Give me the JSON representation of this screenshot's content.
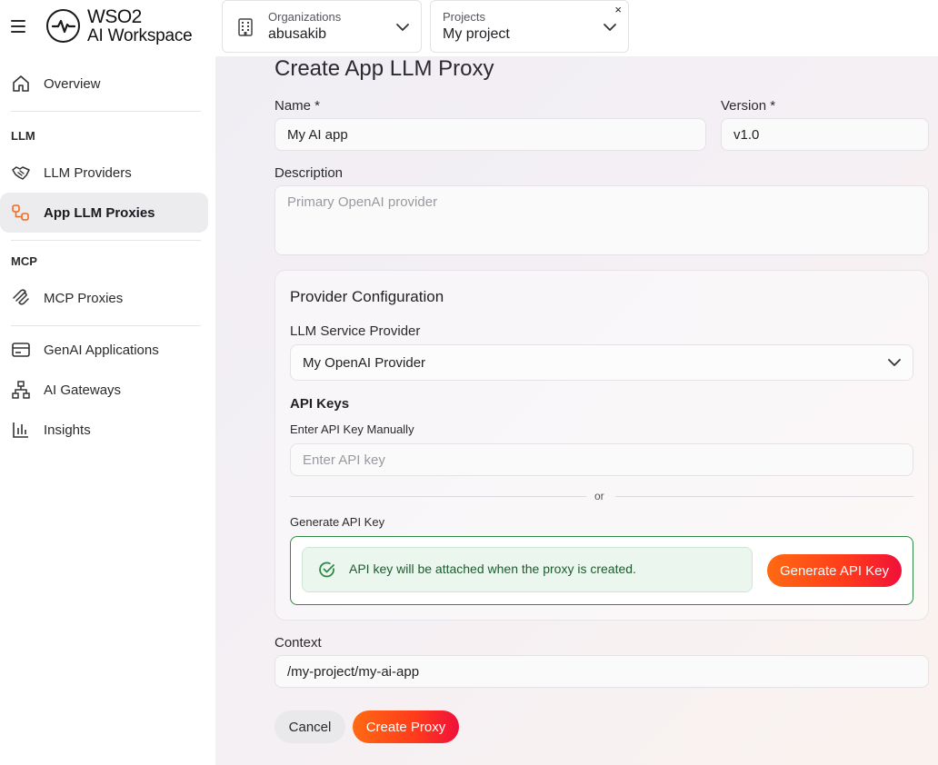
{
  "app": {
    "brand_line1": "WSO2",
    "brand_line2": "AI Workspace"
  },
  "header": {
    "organization": {
      "caption": "Organizations",
      "value": "abusakib"
    },
    "project": {
      "caption": "Projects",
      "value": "My project",
      "clear": "×"
    }
  },
  "sidebar": {
    "overview": "Overview",
    "section_llm": "LLM",
    "llm_providers": "LLM Providers",
    "app_llm_proxies": "App LLM Proxies",
    "section_mcp": "MCP",
    "mcp_proxies": "MCP Proxies",
    "genai_applications": "GenAI Applications",
    "ai_gateways": "AI Gateways",
    "insights": "Insights",
    "active_item": "App LLM Proxies"
  },
  "form": {
    "title": "Create App LLM Proxy",
    "name_label": "Name *",
    "name_value": "My AI app",
    "version_label": "Version *",
    "version_value": "v1.0",
    "description_label": "Description",
    "description_placeholder": "Primary OpenAI provider",
    "provider_config": {
      "title": "Provider Configuration",
      "service_provider_label": "LLM Service Provider",
      "service_provider_value": "My OpenAI Provider",
      "api_keys_title": "API Keys",
      "manual_label": "Enter API Key Manually",
      "manual_placeholder": "Enter API key",
      "or_text": "or",
      "generate_label": "Generate API Key",
      "notice_text": "API key will be attached when the proxy is created.",
      "generate_button": "Generate API Key"
    },
    "context_label": "Context",
    "context_value": "/my-project/my-ai-app",
    "cancel_button": "Cancel",
    "create_button": "Create Proxy"
  },
  "colors": {
    "accent_gradient_start": "#ff6a12",
    "accent_gradient_end": "#f0103a",
    "success_border": "#2f8a46",
    "success_bg": "#ebf7ee"
  }
}
